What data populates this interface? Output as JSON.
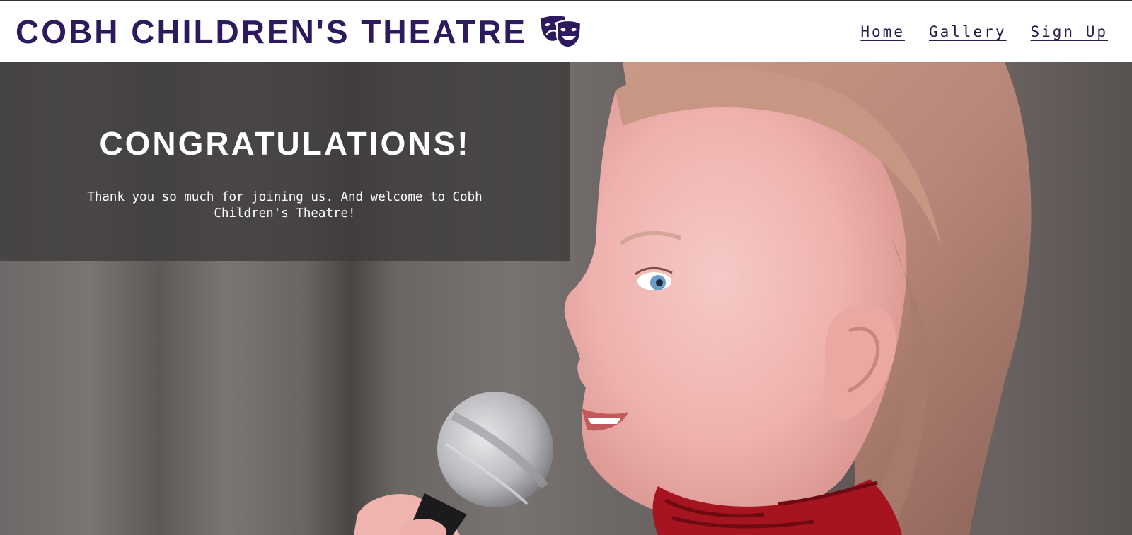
{
  "header": {
    "site_title": "COBH CHILDREN'S THEATRE",
    "logo_icon": "theatre-masks-icon",
    "brand_color": "#2d1a5e"
  },
  "nav": {
    "items": [
      {
        "label": "Home"
      },
      {
        "label": "Gallery"
      },
      {
        "label": "Sign Up"
      }
    ]
  },
  "hero": {
    "heading": "CONGRATULATIONS!",
    "message": "Thank you so much for joining us. And welcome to Cobh Children's Theatre!",
    "overlay_color": "#3e3c3c"
  }
}
